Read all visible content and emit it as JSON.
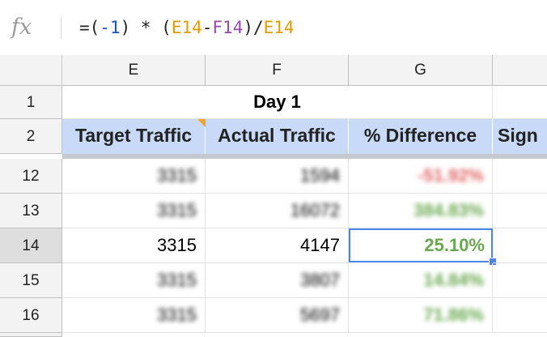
{
  "formula_bar": {
    "fx_label": "fx",
    "tokens": {
      "t1": "=(",
      "t2": "-1",
      "t3": ") * (",
      "t4": "E14",
      "t5": "-",
      "t6": "F14",
      "t7": ")/",
      "t8": "E14"
    }
  },
  "columns": {
    "e": "E",
    "f": "F",
    "g": "G"
  },
  "rows": {
    "r1": "1",
    "r2": "2",
    "r12": "12",
    "r13": "13",
    "r14": "14",
    "r15": "15",
    "r16": "16"
  },
  "sheet": {
    "title": "Day 1",
    "headers": {
      "target": "Target Traffic",
      "actual": "Actual Traffic",
      "difference": "% Difference",
      "sign": "Sign"
    },
    "data": [
      {
        "target": "3315",
        "actual": "1594",
        "diff": "-51.92%"
      },
      {
        "target": "3315",
        "actual": "16072",
        "diff": "384.83%"
      },
      {
        "target": "3315",
        "actual": "4147",
        "diff": "25.10%"
      },
      {
        "target": "3315",
        "actual": "3807",
        "diff": "14.84%"
      },
      {
        "target": "3315",
        "actual": "5697",
        "diff": "71.86%"
      }
    ]
  },
  "colors": {
    "header_fill": "#c9daf8",
    "negative": "#e06666",
    "positive": "#6aa84f",
    "selection": "#4a86e8",
    "comment_marker": "#f4a428"
  }
}
